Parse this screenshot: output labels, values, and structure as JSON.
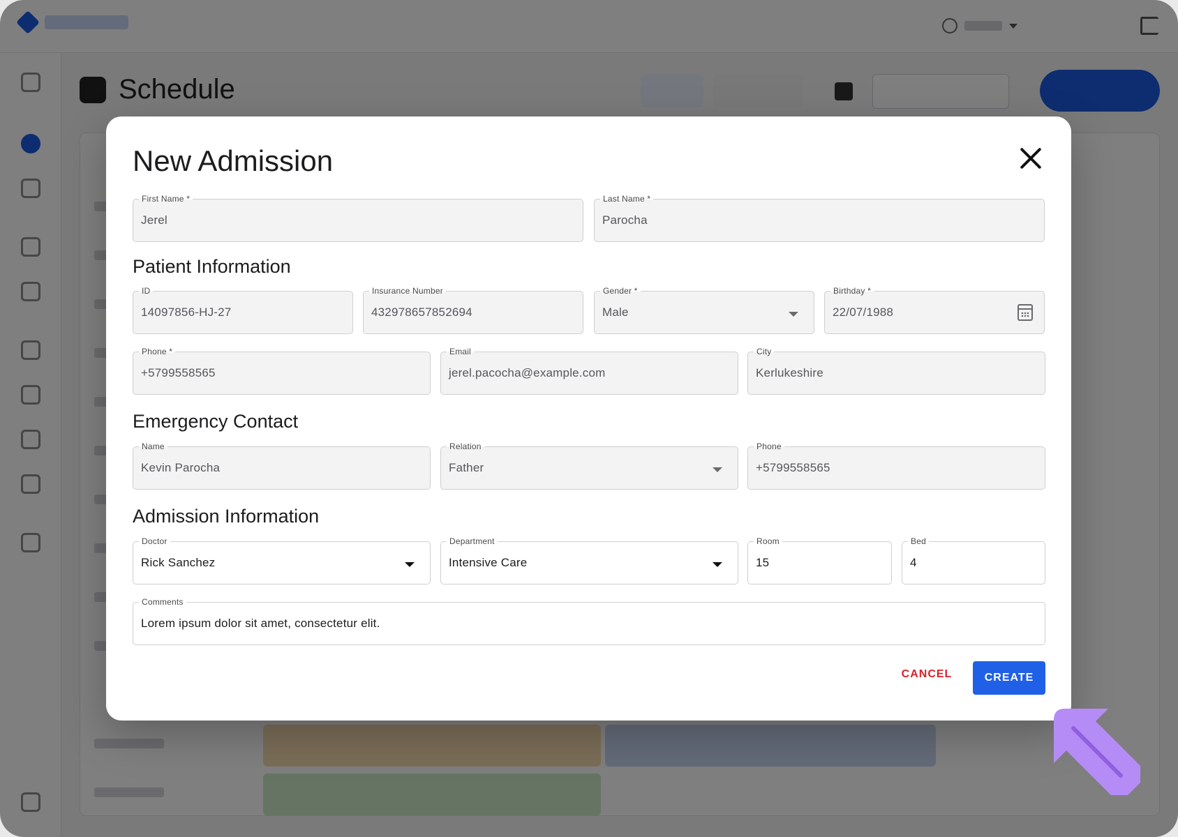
{
  "modal": {
    "title": "New Admission",
    "first_name": {
      "label": "First Name *",
      "value": "Jerel"
    },
    "last_name": {
      "label": "Last Name *",
      "value": "Parocha"
    },
    "patient_section": "Patient Information",
    "patient": {
      "id": {
        "label": "ID",
        "value": "14097856-HJ-27"
      },
      "insurance": {
        "label": "Insurance Number",
        "value": "432978657852694"
      },
      "gender": {
        "label": "Gender *",
        "value": "Male"
      },
      "birthday": {
        "label": "Birthday *",
        "value": "22/07/1988"
      },
      "phone": {
        "label": "Phone *",
        "value": "+5799558565"
      },
      "email": {
        "label": "Email",
        "value": "jerel.pacocha@example.com"
      },
      "city": {
        "label": "City",
        "value": "Kerlukeshire"
      }
    },
    "emergency_section": "Emergency Contact",
    "emergency": {
      "name": {
        "label": "Name",
        "value": "Kevin Parocha"
      },
      "relation": {
        "label": "Relation",
        "value": "Father"
      },
      "phone": {
        "label": "Phone",
        "value": "+5799558565"
      }
    },
    "admission_section": "Admission Information",
    "admission": {
      "doctor": {
        "label": "Doctor",
        "value": "Rick Sanchez"
      },
      "department": {
        "label": "Department",
        "value": "Intensive Care"
      },
      "room": {
        "label": "Room",
        "value": "15"
      },
      "bed": {
        "label": "Bed",
        "value": "4"
      },
      "comments": {
        "label": "Comments",
        "value": "Lorem ipsum dolor sit amet, consectetur elit."
      }
    },
    "cancel_label": "CANCEL",
    "create_label": "CREATE"
  },
  "background": {
    "page_title": "Schedule"
  },
  "colors": {
    "primary": "#1f60e6",
    "danger": "#d8222a",
    "pointer": "#b58cf5"
  }
}
